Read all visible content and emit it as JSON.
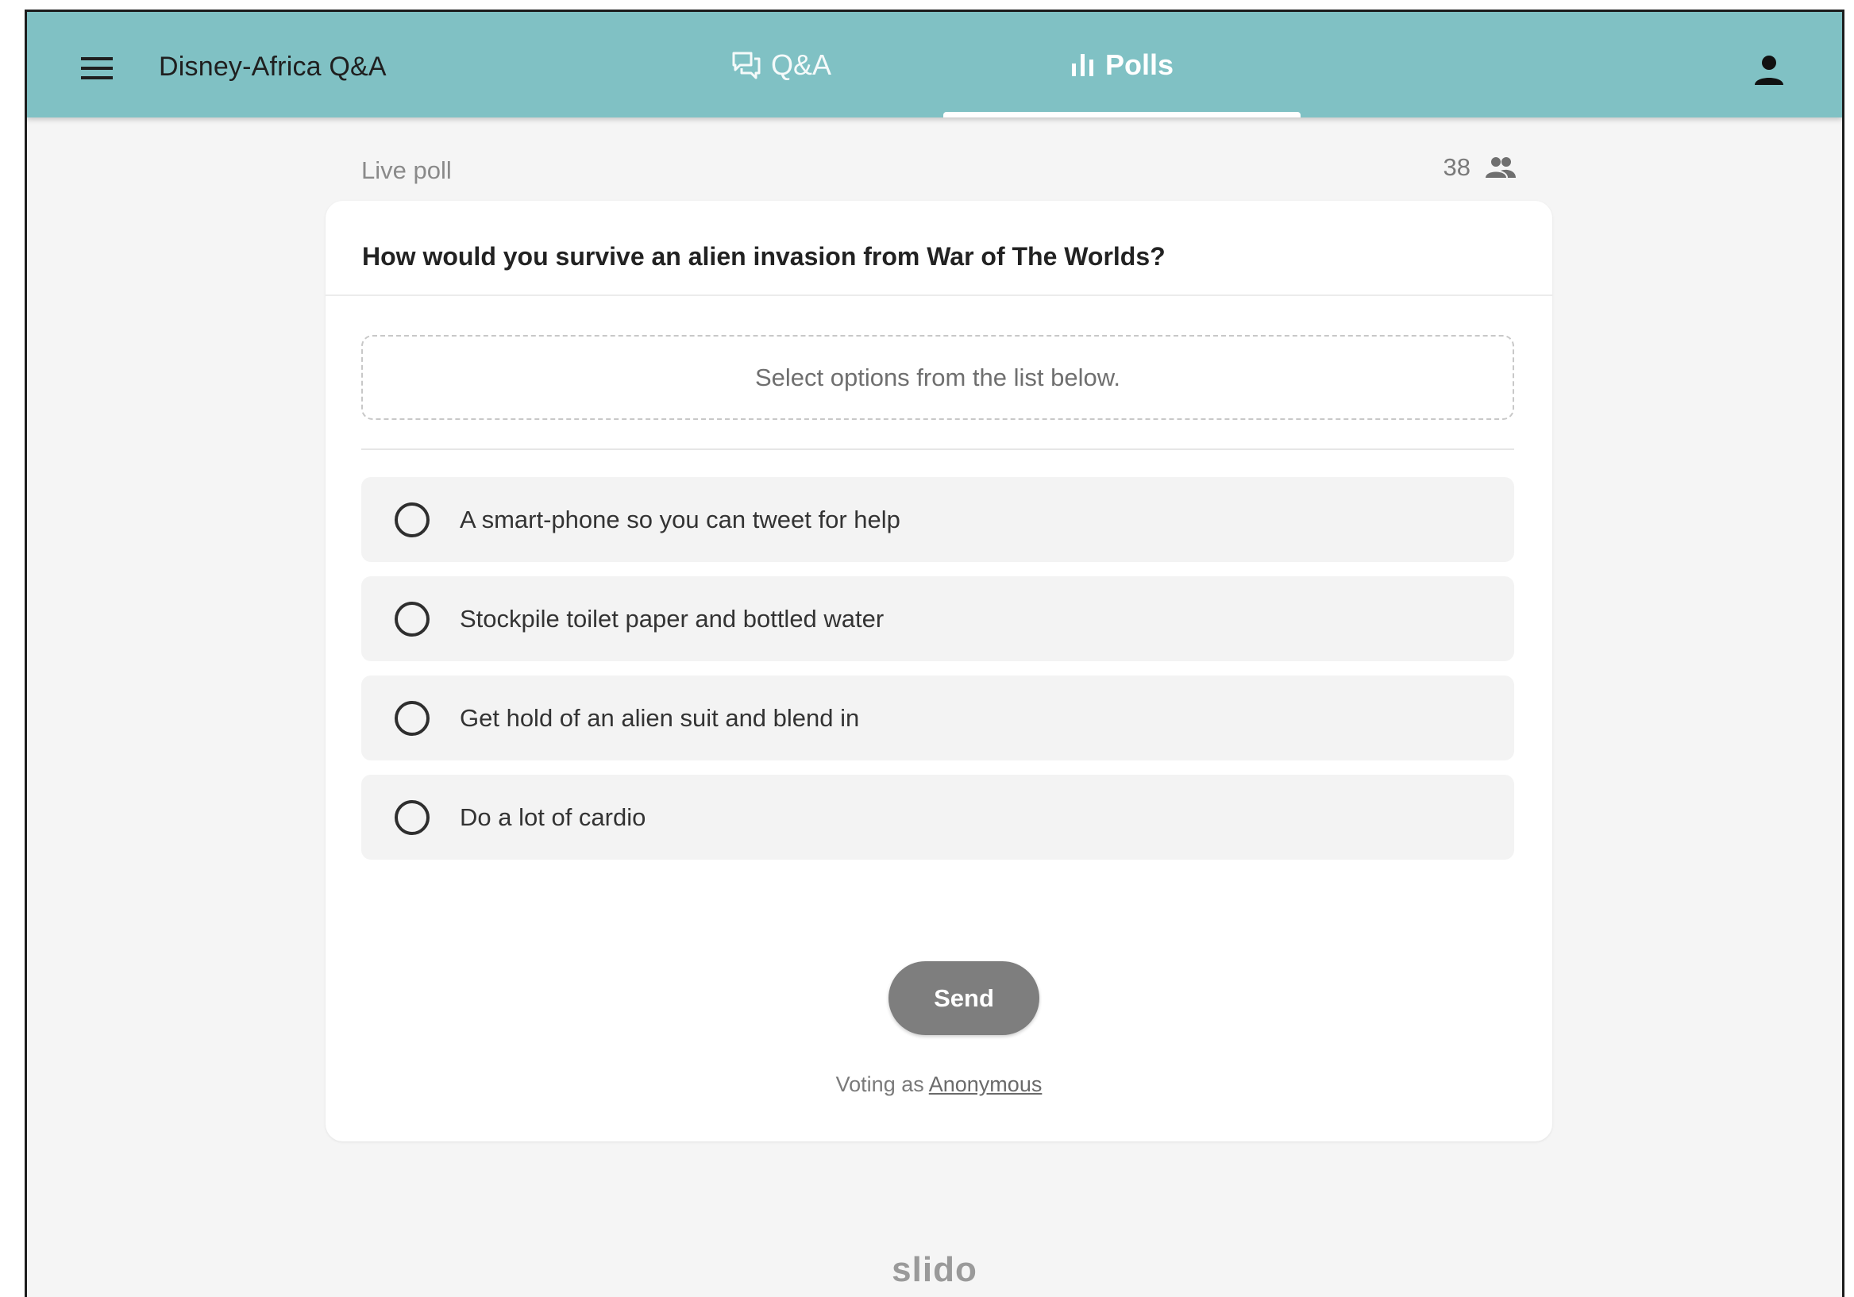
{
  "header": {
    "app_title": "Disney-Africa Q&A",
    "menu_icon": "hamburger-menu-icon",
    "account_icon": "person-icon",
    "background_color": "#80c1c4",
    "tabs": [
      {
        "label": "Q&A",
        "icon": "chat-bubbles-icon",
        "selected": false
      },
      {
        "label": "Polls",
        "icon": "bar-chart-icon",
        "selected": true
      }
    ]
  },
  "poll": {
    "status_label": "Live poll",
    "participant_count": "38",
    "participants_icon": "people-icon",
    "question": "How would you survive an alien invasion from War of The Worlds?",
    "hint": "Select options from the list below.",
    "options": [
      {
        "label": "A smart-phone so you can tweet for help",
        "selected": false
      },
      {
        "label": "Stockpile toilet paper and bottled water",
        "selected": false
      },
      {
        "label": "Get hold of an alien suit and blend in",
        "selected": false
      },
      {
        "label": "Do a lot of cardio",
        "selected": false
      }
    ],
    "send_label": "Send",
    "voting_prefix": "Voting as",
    "voting_name": "Anonymous"
  },
  "footer": {
    "brand": "slido"
  }
}
